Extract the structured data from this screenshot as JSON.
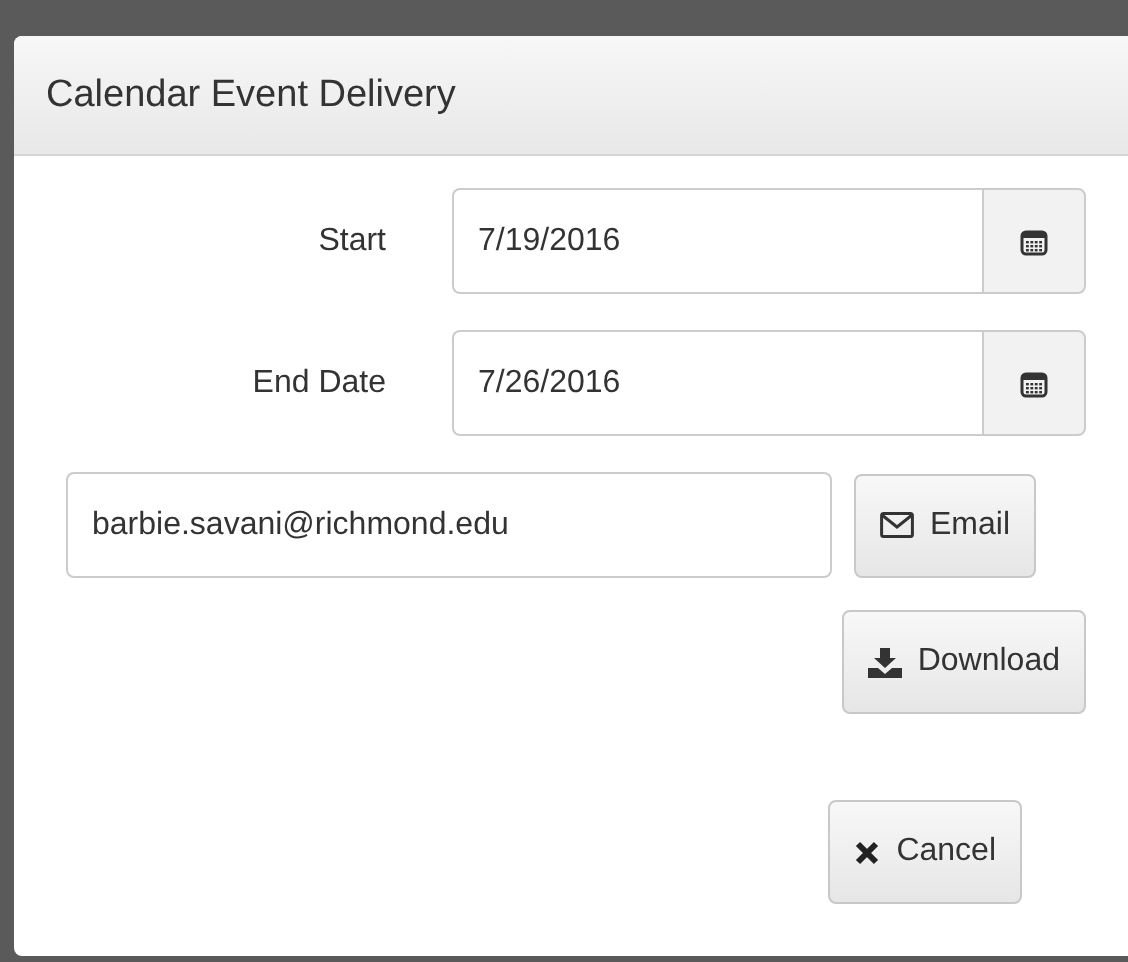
{
  "dialog": {
    "title": "Calendar Event Delivery"
  },
  "date_fields": [
    {
      "label": "Start",
      "value": "7/19/2016"
    },
    {
      "label": "End Date",
      "value": "7/26/2016"
    }
  ],
  "email": {
    "value": "barbie.savani@richmond.edu",
    "button": "Email"
  },
  "download_button": "Download",
  "cancel_button": "Cancel"
}
